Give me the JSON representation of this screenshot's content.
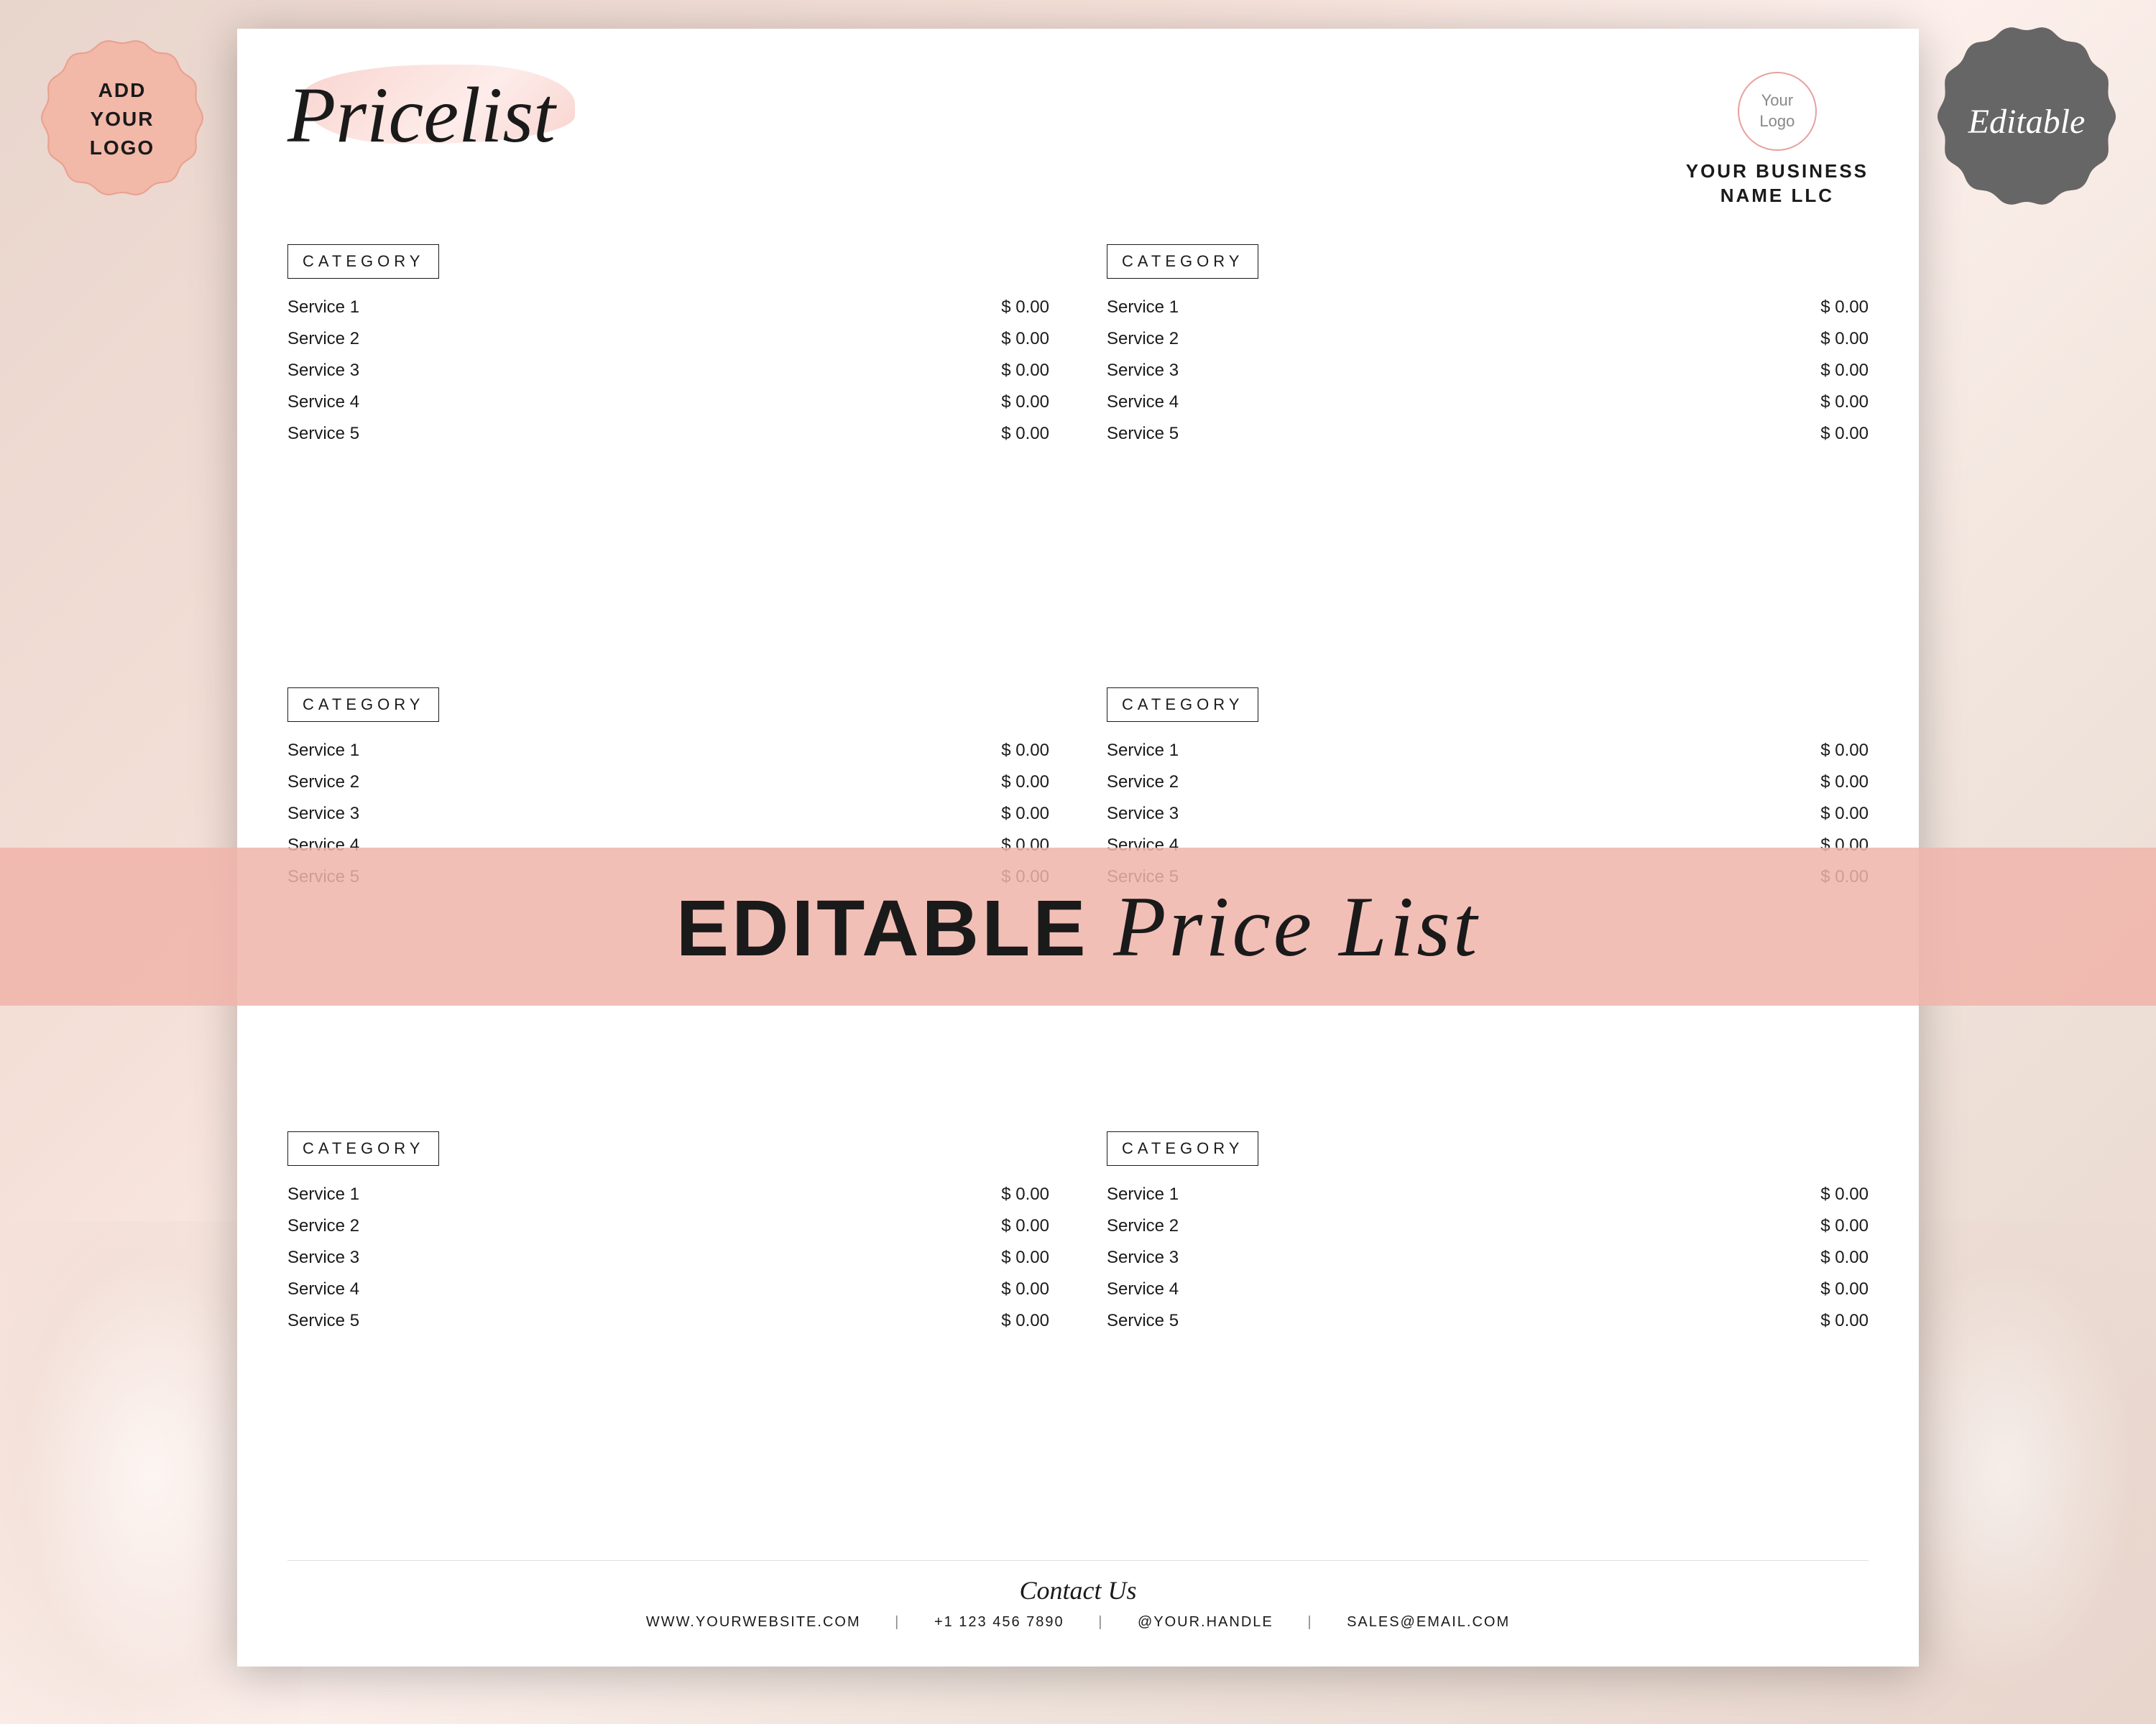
{
  "background": {
    "color": "#f2c5b8"
  },
  "logo_badge": {
    "line1": "ADD",
    "line2": "YOUR",
    "line3": "LOGO"
  },
  "editable_badge": {
    "text": "Editable"
  },
  "document": {
    "title": "Pricelist",
    "logo_circle": {
      "line1": "Your",
      "line2": "Logo"
    },
    "business_name": {
      "line1": "YOUR BUSINESS",
      "line2": "NAME LLC"
    },
    "categories": [
      {
        "id": "cat1",
        "header": "CATEGORY",
        "services": [
          {
            "name": "Service 1",
            "price": "$ 0.00"
          },
          {
            "name": "Service 2",
            "price": "$ 0.00"
          },
          {
            "name": "Service 3",
            "price": "$ 0.00"
          },
          {
            "name": "Service 4",
            "price": "$ 0.00"
          },
          {
            "name": "Service 5",
            "price": "$ 0.00"
          }
        ]
      },
      {
        "id": "cat2",
        "header": "CATEGORY",
        "services": [
          {
            "name": "Service 1",
            "price": "$ 0.00"
          },
          {
            "name": "Service 2",
            "price": "$ 0.00"
          },
          {
            "name": "Service 3",
            "price": "$ 0.00"
          },
          {
            "name": "Service 4",
            "price": "$ 0.00"
          },
          {
            "name": "Service 5",
            "price": "$ 0.00"
          }
        ]
      },
      {
        "id": "cat3",
        "header": "CATEGORY",
        "services": [
          {
            "name": "Service 1",
            "price": "$ 0.00"
          },
          {
            "name": "Service 2",
            "price": "$ 0.00"
          },
          {
            "name": "Service 3",
            "price": "$ 0.00"
          },
          {
            "name": "Service 4",
            "price": "$ 0.00"
          },
          {
            "name": "Service 5",
            "price": "$ 0.00"
          }
        ]
      },
      {
        "id": "cat4",
        "header": "CATEGORY",
        "services": [
          {
            "name": "Service 1",
            "price": "$ 0.00"
          },
          {
            "name": "Service 2",
            "price": "$ 0.00"
          },
          {
            "name": "Service 3",
            "price": "$ 0.00"
          },
          {
            "name": "Service 4",
            "price": "$ 0.00"
          },
          {
            "name": "Service 5",
            "price": "$ 0.00"
          }
        ]
      },
      {
        "id": "cat5",
        "header": "CATEGORY",
        "services": [
          {
            "name": "Service 1",
            "price": "$ 0.00"
          },
          {
            "name": "Service 2",
            "price": "$ 0.00"
          },
          {
            "name": "Service 3",
            "price": "$ 0.00"
          },
          {
            "name": "Service 4",
            "price": "$ 0.00"
          },
          {
            "name": "Service 5",
            "price": "$ 0.00"
          }
        ]
      },
      {
        "id": "cat6",
        "header": "CATEGORY",
        "services": [
          {
            "name": "Service 1",
            "price": "$ 0.00"
          },
          {
            "name": "Service 2",
            "price": "$ 0.00"
          },
          {
            "name": "Service 3",
            "price": "$ 0.00"
          },
          {
            "name": "Service 4",
            "price": "$ 0.00"
          },
          {
            "name": "Service 5",
            "price": "$ 0.00"
          }
        ]
      }
    ],
    "footer": {
      "contact_script": "Contact Us",
      "website": "WWW.YOURWEBSITE.COM",
      "phone": "+1 123 456 7890",
      "handle": "@YOUR.HANDLE",
      "email": "SALES@EMAIL.COM"
    }
  },
  "banner": {
    "text_bold": "EDITABLE",
    "text_script": "Price List"
  }
}
